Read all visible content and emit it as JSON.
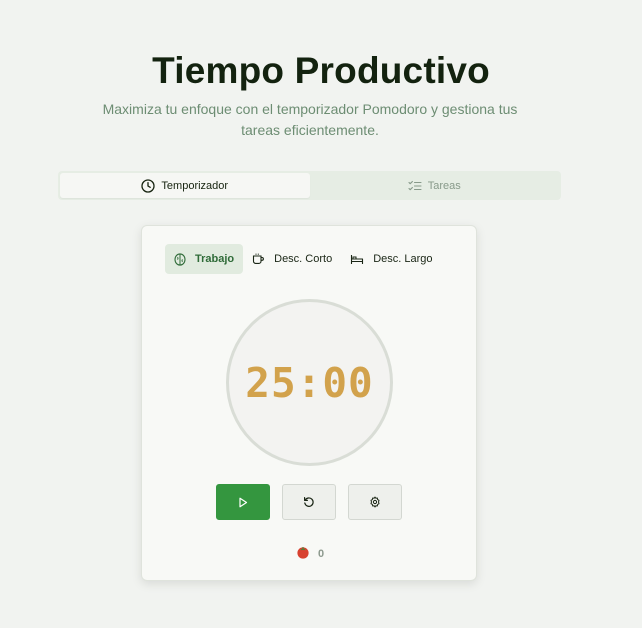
{
  "header": {
    "title": "Tiempo Productivo",
    "subtitle": "Maximiza tu enfoque con el temporizador Pomodoro y gestiona tus tareas eficientemente."
  },
  "tabs": [
    {
      "label": "Temporizador",
      "icon": "clock-icon",
      "active": true
    },
    {
      "label": "Tareas",
      "icon": "checklist-icon",
      "active": false
    }
  ],
  "timer": {
    "modes": [
      {
        "label": "Trabajo",
        "icon": "brain-icon",
        "active": true
      },
      {
        "label": "Desc. Corto",
        "icon": "coffee-icon",
        "active": false
      },
      {
        "label": "Desc. Largo",
        "icon": "bed-icon",
        "active": false
      }
    ],
    "display": "25:00",
    "controls": {
      "play": "play-icon",
      "reset": "reset-icon",
      "settings": "gear-icon"
    },
    "pomodoro_count": "0",
    "pomodoro_icon": "tomato-icon"
  },
  "colors": {
    "background": "#f1f3f0",
    "accent_green": "#34963f",
    "timer_text": "#d2a24c",
    "active_mode_bg": "#e1ebdf"
  }
}
